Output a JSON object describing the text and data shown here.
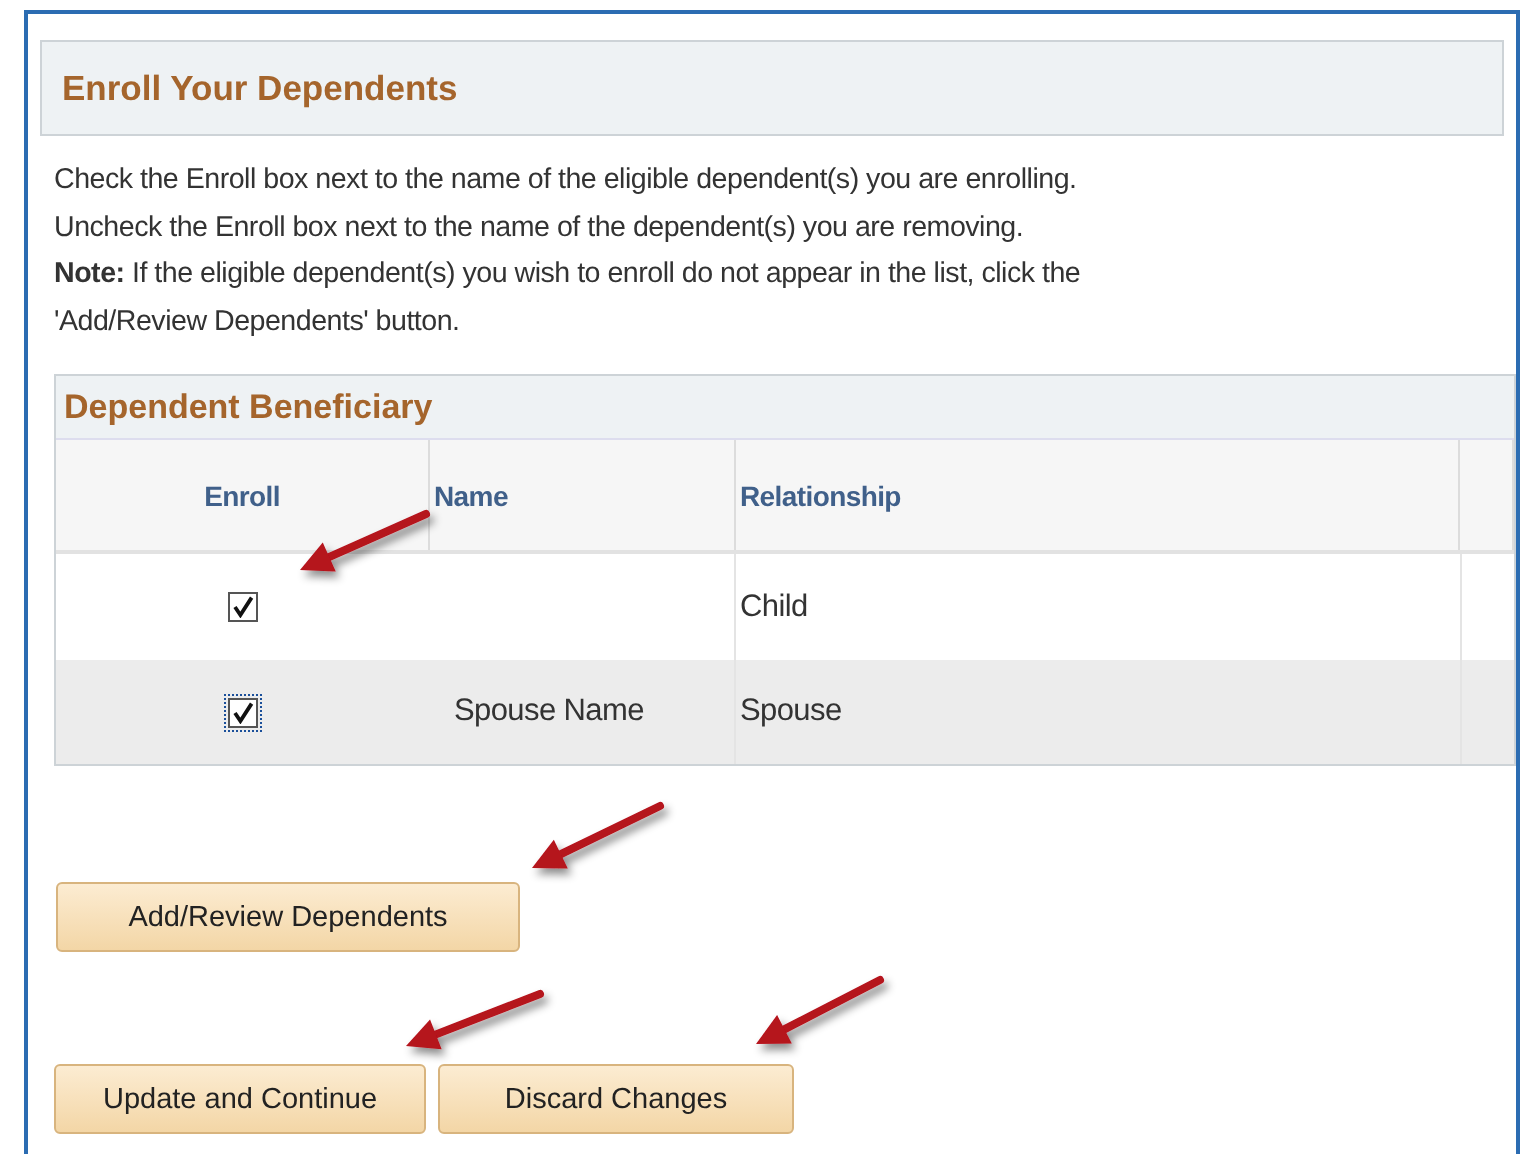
{
  "section": {
    "title": "Enroll Your Dependents"
  },
  "instructions": [
    "Check the Enroll box next to the name of the eligible dependent(s) you are enrolling.",
    "Uncheck the Enroll box next to the name of the dependent(s) you are removing.",
    "**Note:** If the eligible dependent(s) you wish to enroll do not appear in the list, click the 'Add/Review Dependents' button."
  ],
  "grid": {
    "title": "Dependent Beneficiary",
    "columns": [
      "Enroll",
      "Name",
      "Relationship"
    ],
    "rows": [
      {
        "checked": true,
        "focused": false,
        "relationship": "Child"
      },
      {
        "checked": true,
        "focused": true,
        "name": "Spouse Name",
        "relationship": "Spouse"
      }
    ]
  },
  "add_button": "Add/Review Dependents",
  "buttons": [
    "Update and Continue",
    "Discard Changes"
  ]
}
